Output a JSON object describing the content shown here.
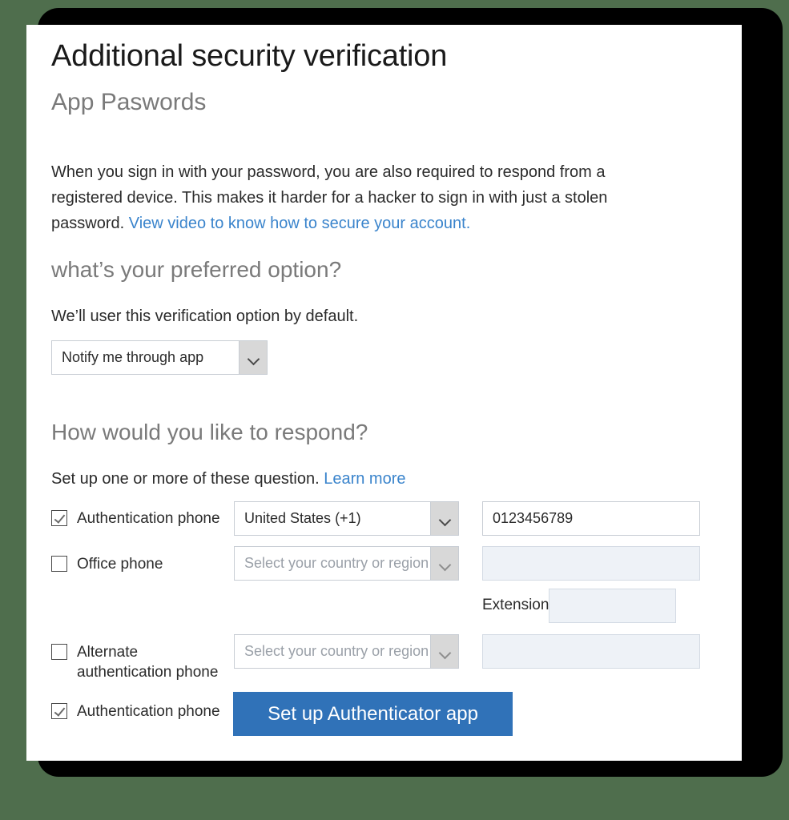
{
  "page": {
    "title": "Additional security verification",
    "subtitle": "App Paswords",
    "intro_text": "When you sign in with your password, you are also required to respond from a registered device. This makes it harder for a hacker to sign in with just a stolen password. ",
    "intro_link": "View video to know how to secure your account."
  },
  "preferred": {
    "heading": "what’s your preferred option?",
    "subtext": "We’ll user this verification option by default.",
    "selected_option": "Notify me through app"
  },
  "respond": {
    "heading": "How would you like to respond?",
    "subtext": "Set up one or more of these question. ",
    "subtext_link": "Learn more",
    "rows": [
      {
        "label": "Authentication phone",
        "checked": true,
        "country": "United States (+1)",
        "country_placeholder": "",
        "phone": "0123456789",
        "disabled": false
      },
      {
        "label": "Office phone",
        "checked": false,
        "country": "",
        "country_placeholder": "Select your country or region",
        "phone": "",
        "disabled": true,
        "extension_label": "Extension",
        "extension_value": ""
      },
      {
        "label": "Alternate authentication phone",
        "checked": false,
        "country": "",
        "country_placeholder": "Select your country or region",
        "phone": "",
        "disabled": true
      },
      {
        "label": "Authentication phone",
        "checked": true,
        "button_label": "Set up Authenticator app"
      }
    ]
  },
  "colors": {
    "background": "#4f6e4d",
    "card": "#ffffff",
    "link": "#3a84cc",
    "primary_button": "#3072b8",
    "disabled_field": "#eef2f7",
    "heading_gray": "#7a7a7a"
  }
}
